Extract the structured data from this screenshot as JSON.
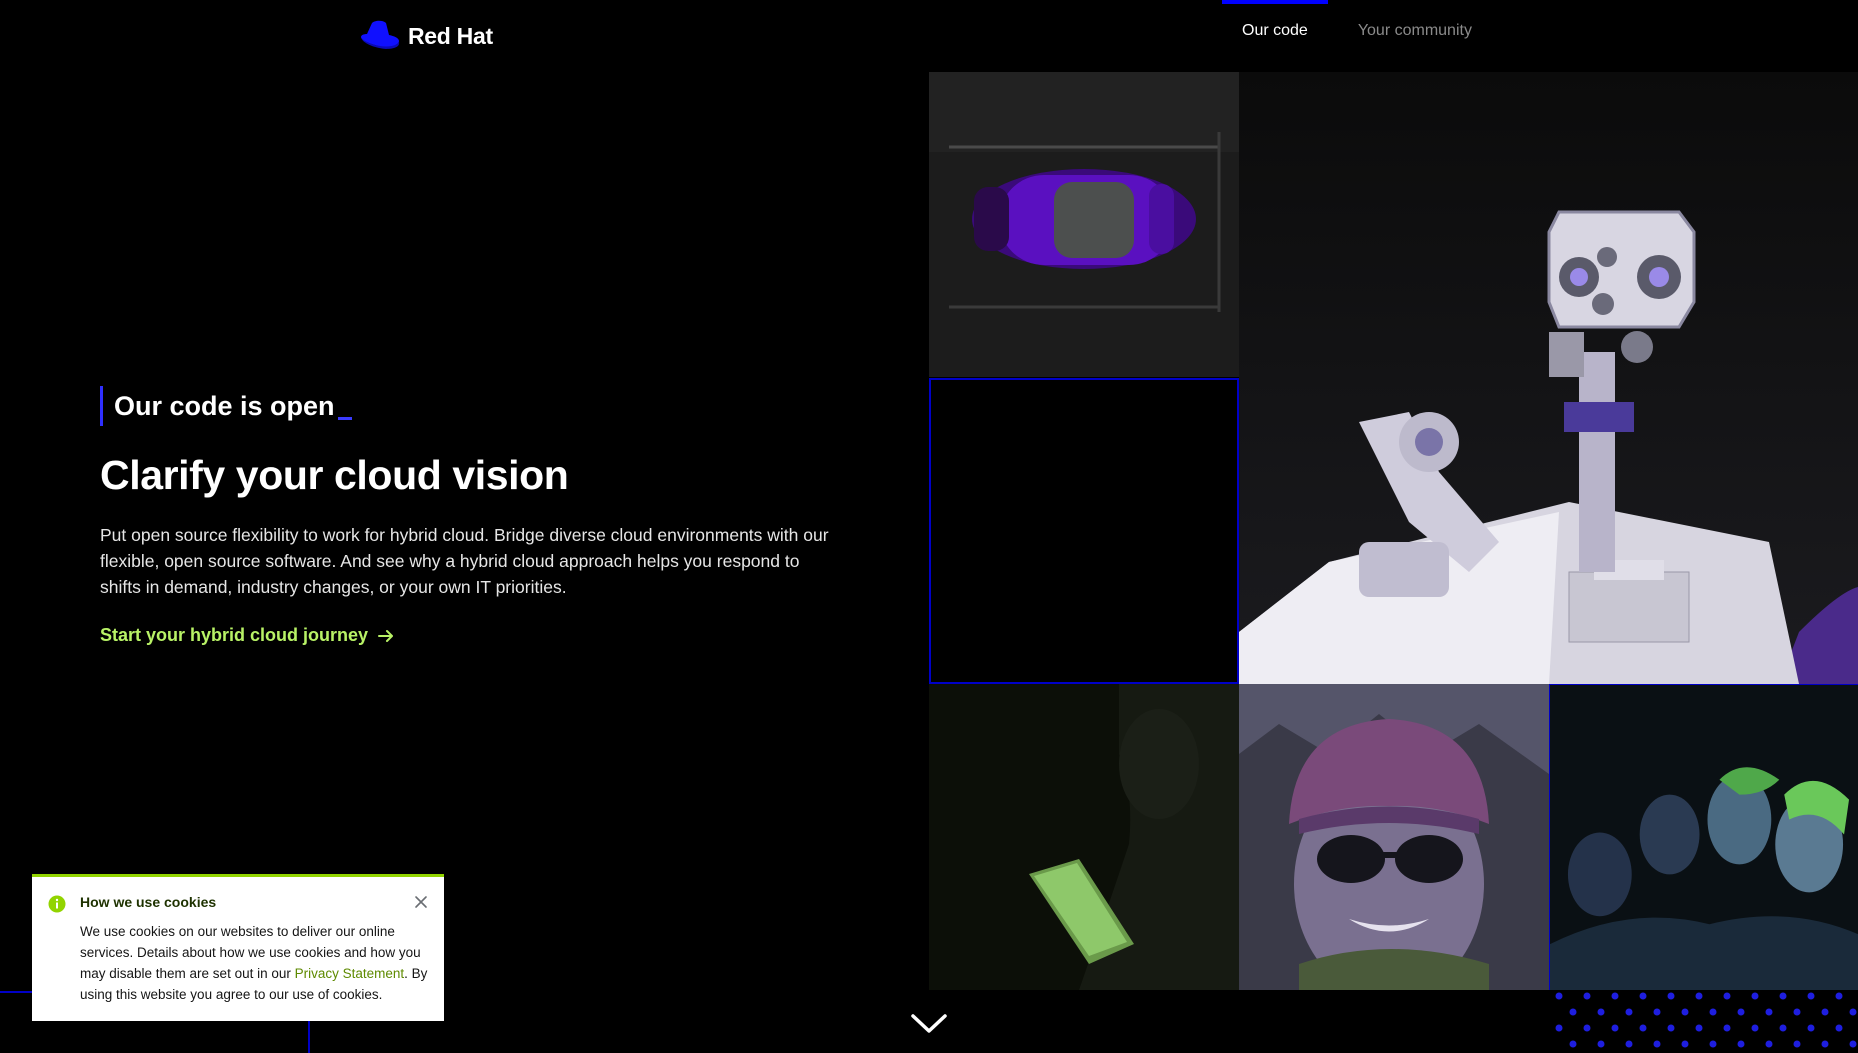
{
  "header": {
    "logo_text": "Red Hat",
    "nav": [
      {
        "label": "Our code",
        "active": true
      },
      {
        "label": "Your community",
        "active": false
      }
    ]
  },
  "hero": {
    "eyebrow": "Our code is open",
    "headline": "Clarify your cloud vision",
    "body": "Put open source flexibility to work for hybrid cloud. Bridge diverse cloud environments with our flexible, open source software. And see why a hybrid cloud approach helps you respond to shifts in demand, industry changes, or your own IT priorities.",
    "cta_label": "Start your hybrid cloud journey"
  },
  "cookie_banner": {
    "title": "How we use cookies",
    "text_before_link": "We use cookies on our websites to deliver our online services. Details about how we use cookies and how you may disable them are set out in our ",
    "link_text": "Privacy Statement",
    "text_after_link": ". By using this website you agree to our use of cookies."
  },
  "colors": {
    "brand_blue": "#0000ff",
    "accent_green": "#b8f266",
    "cookie_border": "#92d400",
    "background": "#000000"
  },
  "icons": {
    "logo": "red-hat-fedora-icon",
    "cta_arrow": "arrow-right-icon",
    "cookie_info": "info-circle-icon",
    "cookie_close": "close-icon",
    "scroll": "chevron-down-icon"
  }
}
